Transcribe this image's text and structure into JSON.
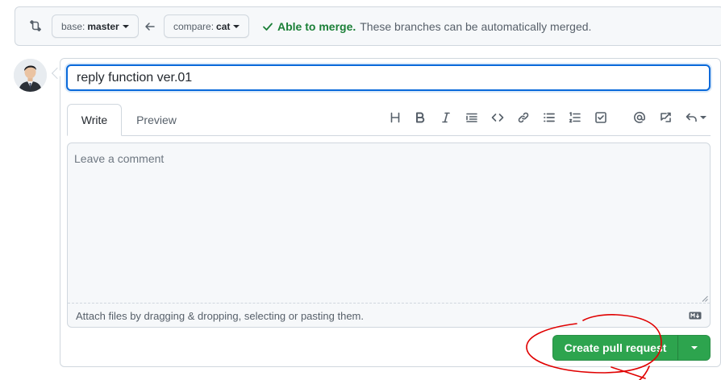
{
  "compare_bar": {
    "icon": "git-compare-icon",
    "base_prefix": "base:",
    "base_branch": "master",
    "compare_prefix": "compare:",
    "compare_branch": "cat",
    "arrow_icon": "arrow-left-icon",
    "merge_ok": "Able to merge.",
    "merge_note": "These branches can be automatically merged.",
    "merge_color": "#1a7f37"
  },
  "pr_form": {
    "title_value": "reply function ver.01",
    "tabs": [
      {
        "label": "Write",
        "active": true
      },
      {
        "label": "Preview",
        "active": false
      }
    ],
    "toolbar_icons": [
      "heading-icon",
      "bold-icon",
      "italic-icon",
      "quote-icon",
      "code-icon",
      "link-icon",
      "unordered-list-icon",
      "ordered-list-icon",
      "task-list-icon",
      "mention-icon",
      "cross-reference-icon",
      "saved-reply-icon"
    ],
    "comment_placeholder": "Leave a comment",
    "attach_text": "Attach files by dragging & dropping, selecting or pasting them.",
    "markdown_icon": "markdown-icon",
    "submit_label": "Create pull request",
    "submit_color": "#2da44e"
  },
  "annotation": {
    "color": "#e00000",
    "shape": "hand-drawn circle around submit button"
  }
}
